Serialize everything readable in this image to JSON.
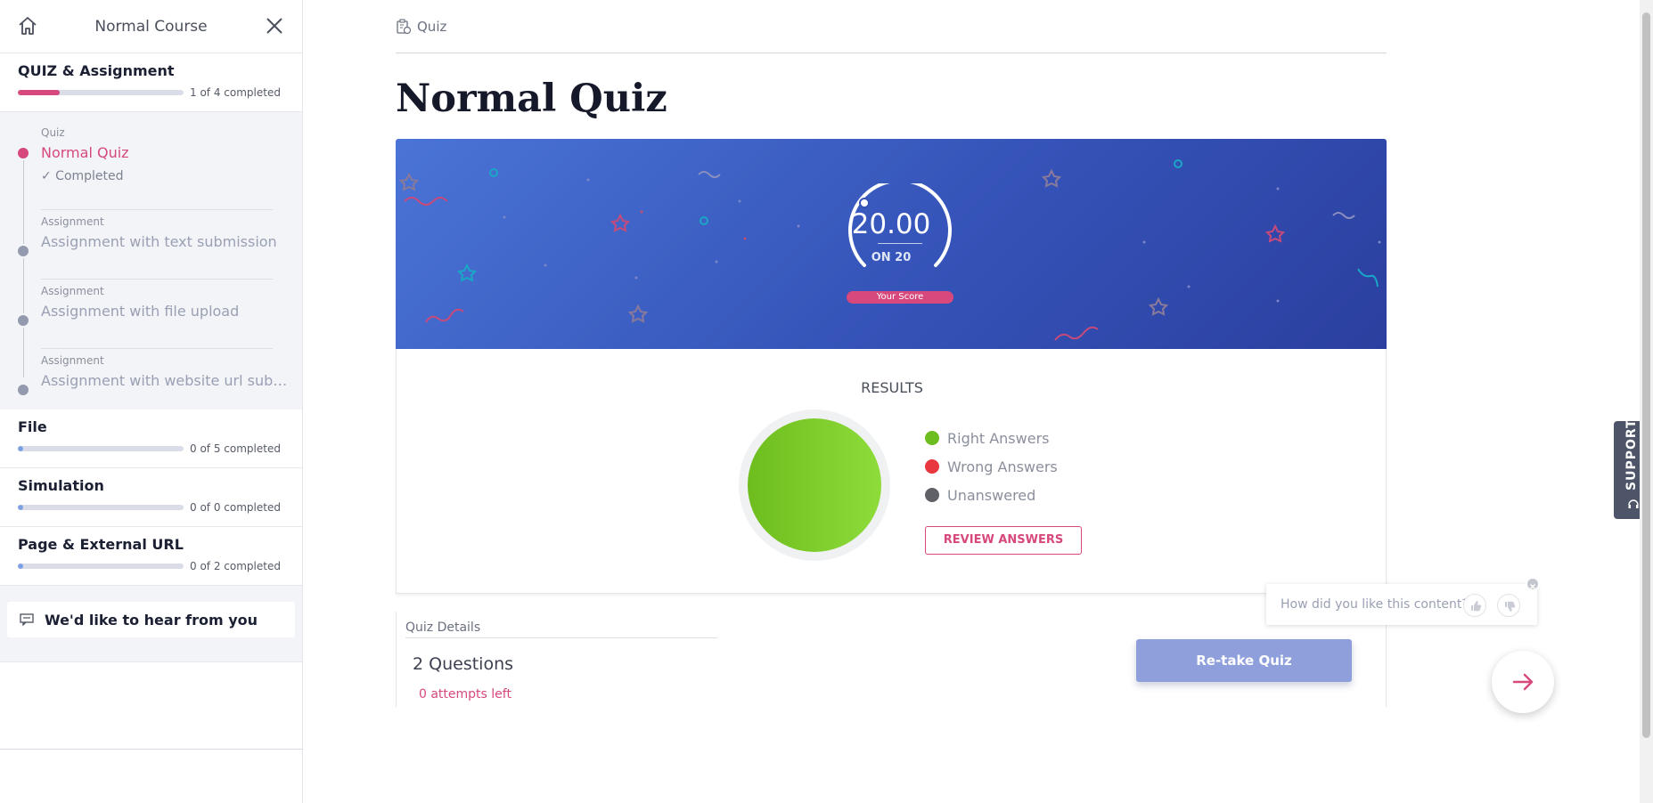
{
  "sidebar": {
    "course_title": "Normal Course",
    "sections": [
      {
        "title": "QUIZ & Assignment",
        "progress_text": "1 of 4 completed",
        "progress": 0.25,
        "color": "#d7487d"
      },
      {
        "title": "File",
        "progress_text": "0 of 5 completed",
        "progress": 0.02,
        "color": "#7ea1e6"
      },
      {
        "title": "Simulation",
        "progress_text": "0 of 0 completed",
        "progress": 0.02,
        "color": "#7ea1e6"
      },
      {
        "title": "Page & External URL",
        "progress_text": "0 of 2 completed",
        "progress": 0.02,
        "color": "#7ea1e6"
      }
    ],
    "items": [
      {
        "kind": "Quiz",
        "name": "Normal Quiz",
        "status": "✓ Completed"
      },
      {
        "kind": "Assignment",
        "name": "Assignment with text submission"
      },
      {
        "kind": "Assignment",
        "name": "Assignment with file upload"
      },
      {
        "kind": "Assignment",
        "name": "Assignment with website url submi..."
      }
    ],
    "feedback_label": "We'd like to hear from you"
  },
  "main": {
    "breadcrumb": "Quiz",
    "title": "Normal Quiz",
    "score": {
      "value": "20.00",
      "of_label": "ON 20",
      "badge": "Your Score"
    },
    "results": {
      "title": "RESULTS",
      "legend": [
        {
          "label": "Right Answers",
          "color": "#6ebd1e"
        },
        {
          "label": "Wrong Answers",
          "color": "#e8373e"
        },
        {
          "label": "Unanswered",
          "color": "#5f6166"
        }
      ],
      "review_button": "REVIEW ANSWERS"
    },
    "details": {
      "label": "Quiz Details",
      "questions": "2 Questions",
      "attempts": "0 attempts left",
      "retake_button": "Re-take Quiz"
    }
  },
  "rating": {
    "question": "How did you like this content?"
  },
  "support": {
    "label": "SUPPORT"
  },
  "colors": {
    "accent": "#d7487d",
    "banner": "#3553b8",
    "retake": "#8f9fdc"
  }
}
